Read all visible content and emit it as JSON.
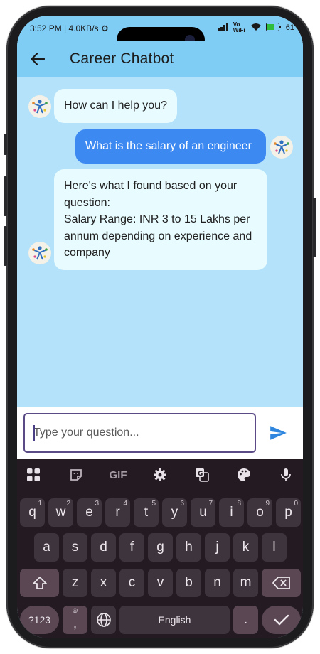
{
  "status_bar": {
    "time": "3:52 PM",
    "speed": "4.0KB/s",
    "network_label": "Vo WiFi",
    "battery": "61"
  },
  "app_bar": {
    "title": "Career Chatbot"
  },
  "messages": [
    {
      "sender": "bot",
      "text": "How can I help you?"
    },
    {
      "sender": "user",
      "text": "What is the salary of an engineer"
    },
    {
      "sender": "bot",
      "lines": [
        "Here's what I found based on your",
        "question:",
        "Salary Range: INR 3 to 15 Lakhs per",
        "annum depending on experience and",
        "company"
      ]
    }
  ],
  "input": {
    "placeholder": "Type your question...",
    "value": ""
  },
  "keyboard": {
    "toolbar": [
      "apps-grid-icon",
      "sticker-icon",
      "GIF",
      "settings-gear-icon",
      "translate-icon",
      "palette-icon",
      "microphone-icon"
    ],
    "row1": [
      {
        "key": "q",
        "hint": "1"
      },
      {
        "key": "w",
        "hint": "2"
      },
      {
        "key": "e",
        "hint": "3"
      },
      {
        "key": "r",
        "hint": "4"
      },
      {
        "key": "t",
        "hint": "5"
      },
      {
        "key": "y",
        "hint": "6"
      },
      {
        "key": "u",
        "hint": "7"
      },
      {
        "key": "i",
        "hint": "8"
      },
      {
        "key": "o",
        "hint": "9"
      },
      {
        "key": "p",
        "hint": "0"
      }
    ],
    "row2": [
      "a",
      "s",
      "d",
      "f",
      "g",
      "h",
      "j",
      "k",
      "l"
    ],
    "row3": [
      "z",
      "x",
      "c",
      "v",
      "b",
      "n",
      "m"
    ],
    "symbols_label": "?123",
    "comma": ",",
    "space_label": "English",
    "period": "."
  },
  "colors": {
    "app_bar": "#7fccf4",
    "chat_background": "#b3e2fa",
    "bot_bubble": "#e8fbff",
    "user_bubble": "#3d89f2",
    "send_icon": "#2e86de",
    "keyboard_bg": "#231a22"
  }
}
